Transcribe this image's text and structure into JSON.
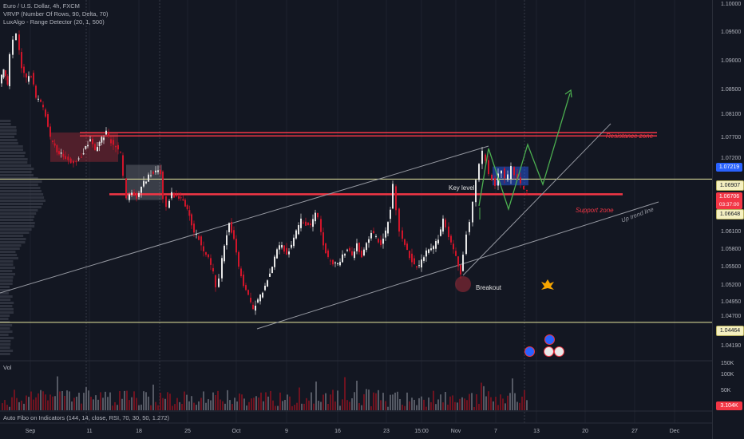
{
  "header": {
    "symbol_line": "Euro / U.S. Dollar, 4h, FXCM",
    "indicator_1": "VRVP (Number Of Rows, 90, Delta, 70)",
    "indicator_2": "LuxAlgo - Range Detector (20, 1, 500)",
    "vol_label": "Vol",
    "footer_indicator": "Auto Fibo on Indicators (144, 14, close, RSI, 70, 30, 50, 1.272)"
  },
  "annotations": {
    "resistance": "Resistance zone",
    "support": "Support zone",
    "key_level": "Key level",
    "up_trend": "Up trend line",
    "breakout": "Breakout"
  },
  "price_axis": {
    "labels": [
      "1.10000",
      "1.09500",
      "1.09000",
      "1.08500",
      "1.08100",
      "1.07700",
      "1.07200",
      "1.06100",
      "1.05800",
      "1.05500",
      "1.05200",
      "1.04950",
      "1.04700",
      "1.04190"
    ],
    "tag_a": "1.07219",
    "tag_b": "1.06907",
    "tag_c": "1.06706",
    "tag_c_timer": "03:37:00",
    "tag_d": "1.06648",
    "tag_e": "1.04464"
  },
  "volume_axis": {
    "labels": [
      "150K",
      "100K",
      "50K"
    ],
    "tag": "3.104K"
  },
  "time_axis": [
    "Sep",
    "11",
    "18",
    "25",
    "Oct",
    "9",
    "16",
    "23",
    "15:00",
    "Nov",
    "7",
    "13",
    "20",
    "27",
    "Dec"
  ],
  "colors": {
    "background": "#131722",
    "bull": "#e6e6e6",
    "bear": "#d0152a",
    "resistance": "#f23645",
    "support": "#f23645",
    "key_level": "#e8e8a0",
    "projection": "#4caf50",
    "trend": "#9598a1"
  },
  "chart_data": {
    "type": "candlestick",
    "symbol": "EUR/USD",
    "timeframe": "4h",
    "ylim": [
      1.0405,
      1.1005
    ],
    "x_ticks": [
      "Sep",
      "11",
      "18",
      "25",
      "Oct",
      "9",
      "16",
      "23",
      "15:00",
      "Nov",
      "7",
      "13",
      "20",
      "27",
      "Dec"
    ],
    "price_path": [
      [
        0,
        1.085
      ],
      [
        5,
        1.088
      ],
      [
        10,
        1.085
      ],
      [
        14,
        1.09
      ],
      [
        18,
        1.093
      ],
      [
        22,
        1.094
      ],
      [
        28,
        1.088
      ],
      [
        34,
        1.086
      ],
      [
        40,
        1.087
      ],
      [
        46,
        1.083
      ],
      [
        52,
        1.082
      ],
      [
        58,
        1.08
      ],
      [
        64,
        1.076
      ],
      [
        72,
        1.074
      ],
      [
        80,
        1.073
      ],
      [
        90,
        1.072
      ],
      [
        100,
        1.0725
      ],
      [
        108,
        1.0745
      ],
      [
        114,
        1.076
      ],
      [
        120,
        1.074
      ],
      [
        128,
        1.076
      ],
      [
        134,
        1.077
      ],
      [
        140,
        1.0755
      ],
      [
        146,
        1.0745
      ],
      [
        152,
        1.0735
      ],
      [
        156,
        1.0695
      ],
      [
        160,
        1.0655
      ],
      [
        166,
        1.067
      ],
      [
        172,
        1.066
      ],
      [
        178,
        1.068
      ],
      [
        184,
        1.069
      ],
      [
        190,
        1.07
      ],
      [
        196,
        1.0705
      ],
      [
        202,
        1.07
      ],
      [
        206,
        1.066
      ],
      [
        210,
        1.0645
      ],
      [
        216,
        1.0665
      ],
      [
        222,
        1.066
      ],
      [
        230,
        1.0655
      ],
      [
        238,
        1.063
      ],
      [
        244,
        1.06
      ],
      [
        250,
        1.059
      ],
      [
        256,
        1.057
      ],
      [
        262,
        1.0555
      ],
      [
        268,
        1.053
      ],
      [
        272,
        1.051
      ],
      [
        276,
        1.0525
      ],
      [
        282,
        1.058
      ],
      [
        288,
        1.0615
      ],
      [
        294,
        1.059
      ],
      [
        300,
        1.054
      ],
      [
        306,
        1.051
      ],
      [
        312,
        1.049
      ],
      [
        318,
        1.047
      ],
      [
        324,
        1.0485
      ],
      [
        330,
        1.05
      ],
      [
        336,
        1.052
      ],
      [
        342,
        1.054
      ],
      [
        348,
        1.057
      ],
      [
        354,
        1.058
      ],
      [
        360,
        1.056
      ],
      [
        366,
        1.058
      ],
      [
        372,
        1.06
      ],
      [
        378,
        1.062
      ],
      [
        384,
        1.0615
      ],
      [
        390,
        1.061
      ],
      [
        396,
        1.063
      ],
      [
        400,
        1.0625
      ],
      [
        406,
        1.058
      ],
      [
        412,
        1.0555
      ],
      [
        418,
        1.0545
      ],
      [
        424,
        1.0545
      ],
      [
        430,
        1.056
      ],
      [
        436,
        1.057
      ],
      [
        442,
        1.056
      ],
      [
        448,
        1.058
      ],
      [
        454,
        1.056
      ],
      [
        460,
        1.058
      ],
      [
        466,
        1.06
      ],
      [
        472,
        1.059
      ],
      [
        478,
        1.058
      ],
      [
        484,
        1.06
      ],
      [
        490,
        1.064
      ],
      [
        494,
        1.068
      ],
      [
        498,
        1.064
      ],
      [
        502,
        1.06
      ],
      [
        508,
        1.058
      ],
      [
        514,
        1.056
      ],
      [
        520,
        1.0545
      ],
      [
        526,
        1.054
      ],
      [
        532,
        1.056
      ],
      [
        538,
        1.057
      ],
      [
        544,
        1.0575
      ],
      [
        550,
        1.059
      ],
      [
        556,
        1.062
      ],
      [
        560,
        1.061
      ],
      [
        566,
        1.058
      ],
      [
        572,
        1.056
      ],
      [
        578,
        1.053
      ],
      [
        582,
        1.056
      ],
      [
        586,
        1.06
      ],
      [
        590,
        1.062
      ],
      [
        594,
        1.065
      ],
      [
        598,
        1.069
      ],
      [
        602,
        1.072
      ],
      [
        606,
        1.0735
      ],
      [
        610,
        1.0725
      ],
      [
        614,
        1.07
      ],
      [
        618,
        1.069
      ],
      [
        622,
        1.068
      ],
      [
        626,
        1.07
      ],
      [
        630,
        1.0705
      ],
      [
        634,
        1.069
      ],
      [
        638,
        1.0695
      ],
      [
        642,
        1.071
      ],
      [
        646,
        1.07
      ],
      [
        650,
        1.069
      ],
      [
        654,
        1.068
      ],
      [
        658,
        1.0675
      ],
      [
        662,
        1.067
      ]
    ],
    "levels": [
      {
        "name": "Resistance zone",
        "from": 1.076,
        "to": 1.077
      },
      {
        "name": "Key level",
        "value": 1.06907
      },
      {
        "name": "Support zone",
        "from": 1.06648,
        "to": 1.0668
      },
      {
        "name": "Lower level",
        "value": 1.04464
      }
    ]
  }
}
